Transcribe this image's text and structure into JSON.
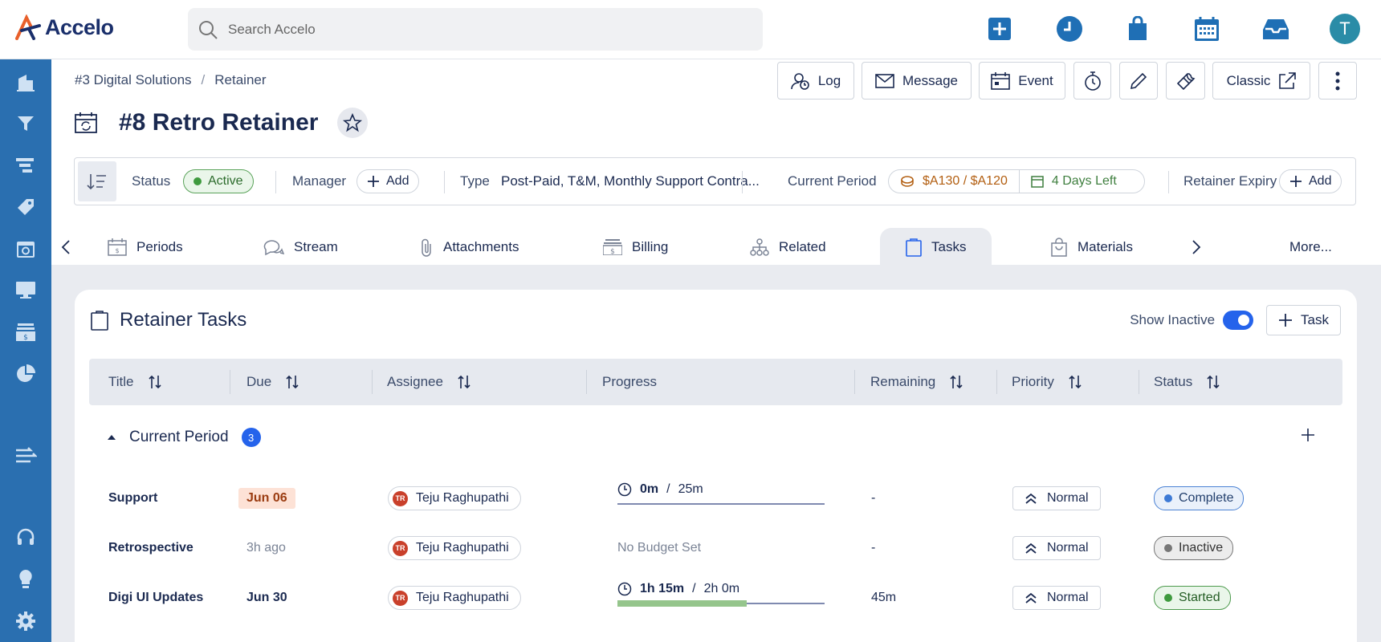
{
  "app": {
    "name": "Accelo"
  },
  "search": {
    "placeholder": "Search Accelo"
  },
  "user": {
    "initial": "T"
  },
  "breadcrumb": {
    "parent": "#3 Digital Solutions",
    "sep": "/",
    "current": "Retainer"
  },
  "actions": {
    "log": "Log",
    "message": "Message",
    "event": "Event",
    "classic": "Classic"
  },
  "page": {
    "title": "#8 Retro Retainer"
  },
  "info": {
    "status_label": "Status",
    "status_value": "Active",
    "manager_label": "Manager",
    "manager_add": "Add",
    "type_label": "Type",
    "type_value": "Post-Paid, T&M, Monthly Support Contra...",
    "period_label": "Current Period",
    "budget": "$A130 / $A120",
    "days_left": "4 Days Left",
    "expiry_label": "Retainer Expiry",
    "expiry_add": "Add"
  },
  "tabs": {
    "periods": "Periods",
    "stream": "Stream",
    "attachments": "Attachments",
    "billing": "Billing",
    "related": "Related",
    "tasks": "Tasks",
    "materials": "Materials",
    "more": "More..."
  },
  "tasks_card": {
    "title": "Retainer Tasks",
    "show_inactive": "Show Inactive",
    "add_task": "Task"
  },
  "table": {
    "headers": {
      "title": "Title",
      "due": "Due",
      "assignee": "Assignee",
      "progress": "Progress",
      "remaining": "Remaining",
      "priority": "Priority",
      "status": "Status"
    },
    "group": {
      "label": "Current Period",
      "count": "3"
    },
    "rows": [
      {
        "title": "Support",
        "due": "Jun 06",
        "assignee_initials": "TR",
        "assignee": "Teju Raghupathi",
        "progress_used": "0m",
        "progress_sep": "/",
        "progress_budget": "25m",
        "progress_fraction": 0,
        "remaining": "-",
        "priority": "Normal",
        "status": "Complete"
      },
      {
        "title": "Retrospective",
        "due": "3h ago",
        "assignee_initials": "TR",
        "assignee": "Teju Raghupathi",
        "progress_text": "No Budget Set",
        "remaining": "-",
        "priority": "Normal",
        "status": "Inactive"
      },
      {
        "title": "Digi UI Updates",
        "due": "Jun 30",
        "assignee_initials": "TR",
        "assignee": "Teju Raghupathi",
        "progress_used": "1h 15m",
        "progress_sep": "/",
        "progress_budget": "2h 0m",
        "progress_fraction": 0.625,
        "remaining": "45m",
        "priority": "Normal",
        "status": "Started"
      }
    ]
  },
  "colors": {
    "sidebar": "#2a6fb0",
    "accent": "#2563eb",
    "top_icons": "#1f6fb5"
  },
  "icons": {
    "top": [
      "plus-square-icon",
      "clock-icon",
      "bag-icon",
      "calendar-icon",
      "inbox-icon"
    ],
    "sidebar": [
      "building-icon",
      "funnel-icon",
      "gantt-icon",
      "tag-icon",
      "calendar-sync-icon",
      "monitor-icon",
      "billing-icon",
      "pie-chart-icon",
      "arrows-icon",
      "headset-icon",
      "lightbulb-icon",
      "gear-icon"
    ]
  }
}
